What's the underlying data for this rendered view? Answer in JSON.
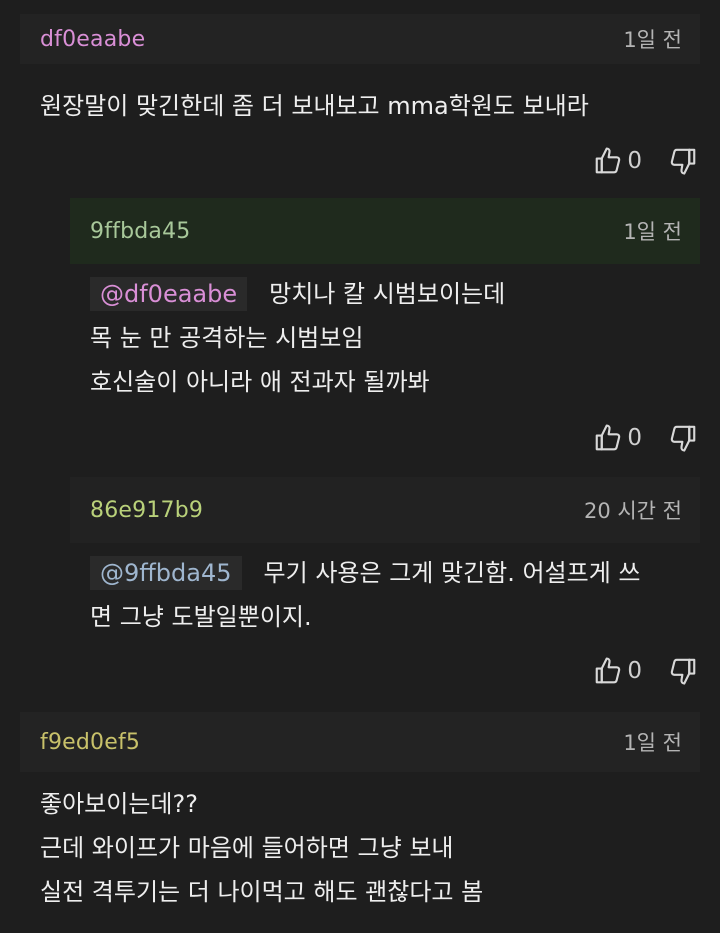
{
  "comments": [
    {
      "author": "df0eaabe",
      "author_color": "#d98fd6",
      "time": "1일 전",
      "lines": [
        "원장말이 맞긴한데 좀 더 보내보고 mma학원도 보내라"
      ],
      "likes": "0",
      "actions": {
        "like_icon": "thumbs-up-icon",
        "dislike_icon": "thumbs-down-icon"
      }
    },
    {
      "author": "9ffbda45",
      "author_color": "#a8c89a",
      "time": "1일 전",
      "mention": "@df0eaabe",
      "mention_color": "#d98fd6",
      "first_line": "망치나 칼 시범보이는데",
      "lines": [
        "목 눈 만 공격하는 시범보임",
        "호신술이 아니라 애 전과자 될까봐"
      ],
      "likes": "0",
      "actions": {
        "like_icon": "thumbs-up-icon",
        "dislike_icon": "thumbs-down-icon"
      }
    },
    {
      "author": "86e917b9",
      "author_color": "#b9d17a",
      "time": "20 시간 전",
      "mention": "@9ffbda45",
      "mention_color": "#9fb6cf",
      "first_line": "무기 사용은 그게 맞긴함. 어설프게 쓰",
      "lines": [
        "면 그냥 도발일뿐이지."
      ],
      "likes": "0",
      "actions": {
        "like_icon": "thumbs-up-icon",
        "dislike_icon": "thumbs-down-icon"
      }
    },
    {
      "author": "f9ed0ef5",
      "author_color": "#c8c16a",
      "time": "1일 전",
      "lines": [
        "좋아보이는데??",
        "근데 와이프가 마음에 들어하면 그냥 보내",
        "실전 격투기는 더 나이먹고 해도 괜찮다고 봄"
      ]
    }
  ]
}
